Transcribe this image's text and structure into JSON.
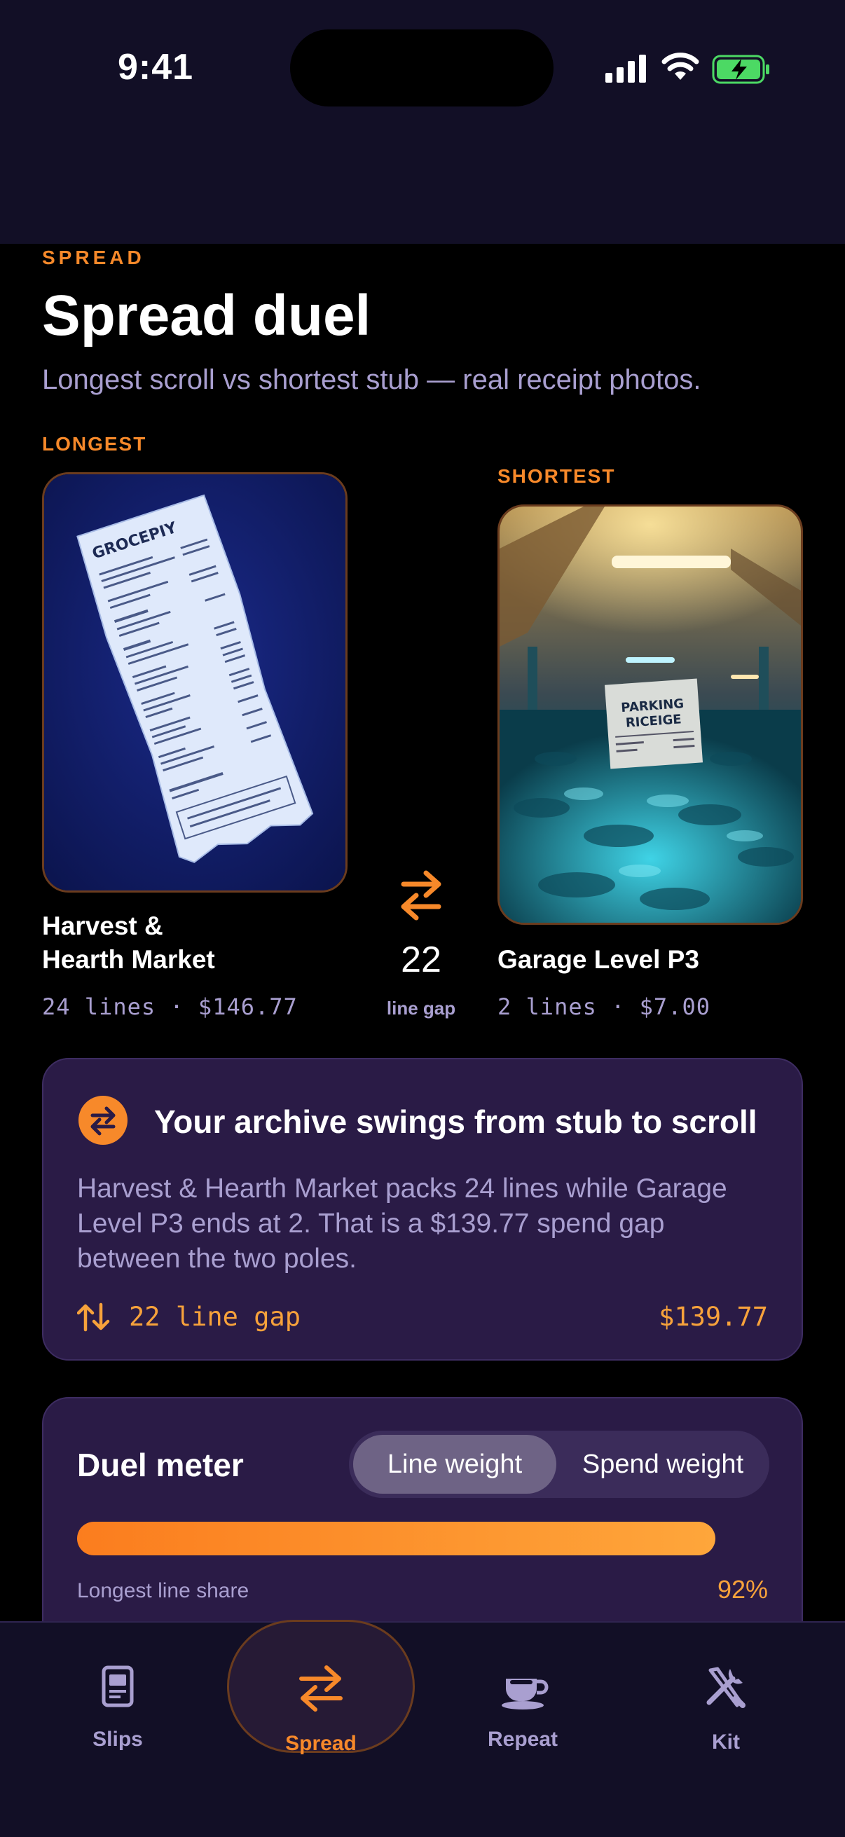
{
  "status_bar": {
    "time": "9:41"
  },
  "header": {
    "eyebrow": "SPREAD",
    "title": "Spread duel",
    "subtitle": "Longest scroll vs shortest stub — real receipt photos."
  },
  "longest": {
    "label": "LONGEST",
    "name_line1": "Harvest &",
    "name_line2": "Hearth Market",
    "meta": "24 lines · $146.77",
    "photo_text": "GROCEPIY"
  },
  "shortest": {
    "label": "SHORTEST",
    "name": "Garage Level P3",
    "meta": "2 lines · $7.00",
    "photo_text_1": "PARKING",
    "photo_text_2": "RICEIGE"
  },
  "gap": {
    "value": "22",
    "label": "line gap"
  },
  "insight_card": {
    "title": "Your archive swings from stub to scroll",
    "body": "Harvest & Hearth Market packs 24 lines while Garage Level P3 ends at 2. That is a $139.77 spend gap between the two poles.",
    "gap_text": "22 line gap",
    "amount": "$139.77"
  },
  "meter_card": {
    "title": "Duel meter",
    "segments": [
      "Line weight",
      "Spend weight"
    ],
    "selected_segment": "Line weight",
    "bar_label": "Longest line share",
    "bar_percent": "92%",
    "bar_value": 0.92
  },
  "tabs": [
    {
      "label": "Slips",
      "icon": "receipt-icon"
    },
    {
      "label": "Spread",
      "icon": "swap-arrows-icon",
      "active": true
    },
    {
      "label": "Repeat",
      "icon": "coffee-cup-icon"
    },
    {
      "label": "Kit",
      "icon": "tools-icon"
    }
  ],
  "colors": {
    "accent": "#f7892a",
    "card": "#2a1b46",
    "muted": "#a99fd0",
    "background": "#000000",
    "chrome": "#120f26"
  }
}
